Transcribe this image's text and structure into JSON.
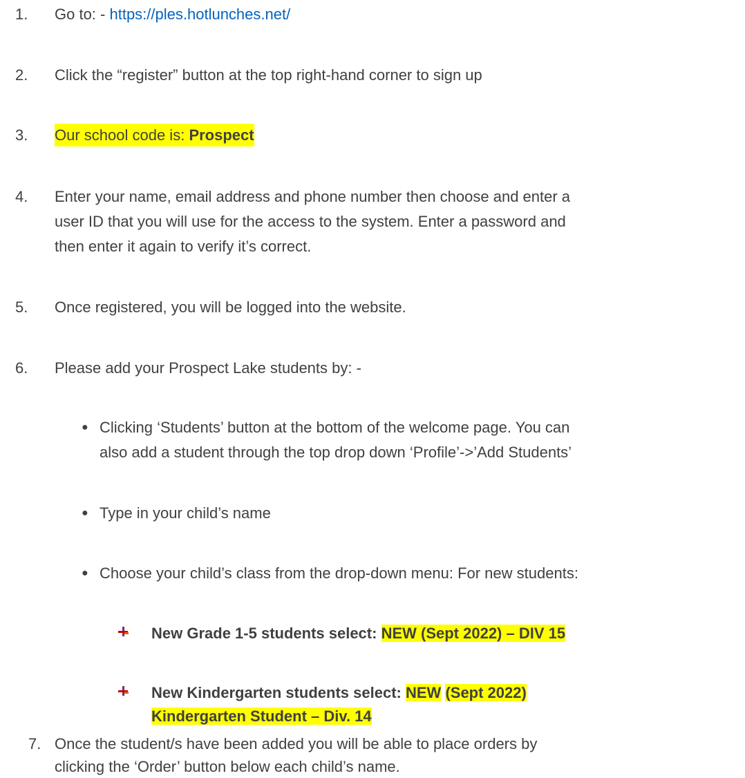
{
  "steps": [
    {
      "num": "1.",
      "text": "Go to: -  ",
      "link": "https://ples.hotlunches.net/"
    },
    {
      "num": "2.",
      "text": "Click the “register” button at the top right-hand corner to sign up"
    },
    {
      "num": "3.",
      "text_prefix": "Our school code is: ",
      "text_bold": "Prospect"
    },
    {
      "num": "4.",
      "lines": [
        "Enter your name, email address and phone number then choose and enter a",
        "user ID that you will use for the access to the system. Enter a password and",
        "then enter it again to verify it’s correct."
      ]
    },
    {
      "num": "5.",
      "text": "Once registered, you will be logged into the website."
    },
    {
      "num": "6.",
      "text": "Please add your Prospect Lake students by:  -"
    }
  ],
  "bullets": [
    {
      "lines": [
        "Clicking ‘Students’ button at the bottom of the welcome page.  You can",
        "also add a student through the top drop down ‘Profile’->’Add Students’"
      ]
    },
    {
      "lines": [
        "Type in your child’s name"
      ]
    },
    {
      "lines": [
        "Choose your child’s class from the drop-down menu:  For new students:"
      ]
    }
  ],
  "sub_bullets": [
    {
      "label": "New Grade 1-5 students select:  ",
      "value": "NEW (Sept 2022) – DIV 15"
    },
    {
      "label": "New Kindergarten students select: ",
      "value_a": "NEW",
      "value_b": "(Sept 2022)",
      "value_line2": "Kindergarten Student – Div. 14"
    }
  ],
  "step7": {
    "num": "7.",
    "lines": [
      "Once the student/s have been added you will be able to place orders by",
      "clicking the ‘Order’ button below each child’s name."
    ]
  },
  "colors": {
    "text": "#404040",
    "link": "#0563c1",
    "highlight": "#ffff00"
  }
}
